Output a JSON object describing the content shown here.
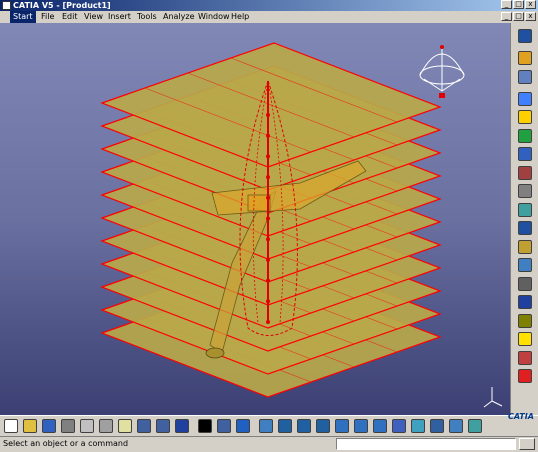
{
  "window": {
    "title": "CATIA V5 - [Product1]"
  },
  "window_buttons": [
    "_",
    "□",
    "x"
  ],
  "menu": {
    "items": [
      "Start",
      "File",
      "Edit",
      "View",
      "Insert",
      "Tools",
      "Analyze",
      "Window",
      "Help"
    ]
  },
  "status": {
    "message": "Select an object or a command",
    "command_placeholder": ""
  },
  "logo": {
    "text": "CATIA"
  },
  "colors": {
    "plane_fill": "#b8a84a",
    "plane_edge": "#ff0000",
    "viewport_top": "#8188b6",
    "viewport_bottom": "#3b3f73",
    "axis_red": "#e00000"
  },
  "toolbar_icons": [
    "new-icon",
    "open-icon",
    "save-icon",
    "print-icon",
    "cut-icon",
    "copy-icon",
    "paste-icon",
    "undo-icon",
    "redo-icon",
    "whats-this-icon",
    "formula-icon",
    "catalog-icon",
    "graph-tree-icon",
    "fly-mode-icon",
    "fit-all-icon",
    "pan-icon",
    "rotate-icon",
    "zoom-in-icon",
    "zoom-out-icon",
    "normal-view-icon",
    "multi-view-icon",
    "view-mode-icon",
    "hide-show-icon",
    "swap-visible-icon",
    "measure-icon"
  ],
  "right_icons": [
    "workbench-icon",
    "select-icon",
    "space-analysis-icon",
    "product-icon",
    "component-icon",
    "part-icon",
    "existing-component-icon",
    "replace-icon",
    "graph-order-icon",
    "generate-numbering-icon",
    "bom-icon",
    "multi-instantiation-icon",
    "fast-multi-instantiation-icon",
    "reorder-icon",
    "constraint-icon",
    "snap-icon",
    "smart-move-icon",
    "explode-icon",
    "stop-manipulate-icon"
  ]
}
